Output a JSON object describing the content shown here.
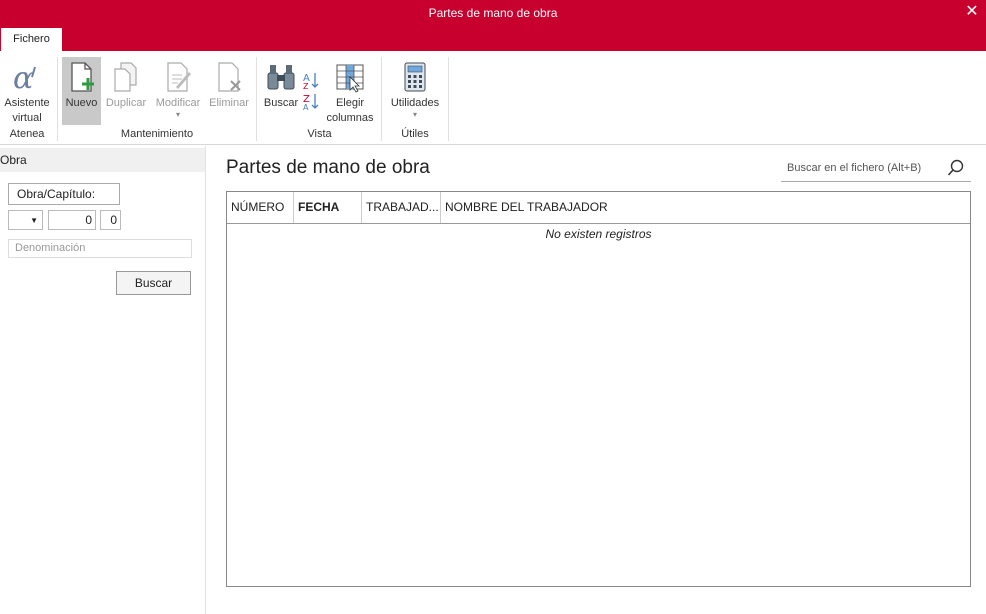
{
  "window": {
    "title": "Partes de mano de obra",
    "close_symbol": "✕"
  },
  "tabs": [
    {
      "label": "Fichero",
      "active": true
    }
  ],
  "ribbon": {
    "groups": [
      {
        "label": "Atenea"
      },
      {
        "label": "Mantenimiento"
      },
      {
        "label": "Vista"
      },
      {
        "label": "Útiles"
      }
    ],
    "buttons": {
      "asistente": {
        "line1": "Asistente",
        "line2": "virtual",
        "icon": "alpha-icon"
      },
      "nuevo": {
        "label": "Nuevo",
        "icon": "new-document-icon",
        "pressed": true
      },
      "duplicar": {
        "label": "Duplicar",
        "icon": "duplicate-icon",
        "disabled": true
      },
      "modificar": {
        "label": "Modificar",
        "icon": "edit-document-icon",
        "disabled": true
      },
      "eliminar": {
        "label": "Eliminar",
        "icon": "delete-document-icon",
        "disabled": true
      },
      "buscar": {
        "label": "Buscar",
        "icon": "binoculars-icon"
      },
      "elegir": {
        "line1": "Elegir",
        "line2": "columnas",
        "icon": "columns-icon"
      },
      "utilidades": {
        "label": "Utilidades",
        "icon": "calculator-icon"
      }
    }
  },
  "left_panel": {
    "header": "Obra",
    "field_label": "Obra/Capítulo:",
    "num1": "0",
    "num2": "0",
    "denominacion_placeholder": "Denominación",
    "search_button": "Buscar"
  },
  "main": {
    "title": "Partes de mano de obra",
    "search_placeholder": "Buscar en el fichero (Alt+B)",
    "columns": [
      "NÚMERO",
      "FECHA",
      "TRABAJAD...",
      "NOMBRE DEL TRABAJADOR"
    ],
    "empty_message": "No existen registros"
  },
  "colors": {
    "brand": "#c8002d",
    "new_plus": "#2e9b3f"
  }
}
